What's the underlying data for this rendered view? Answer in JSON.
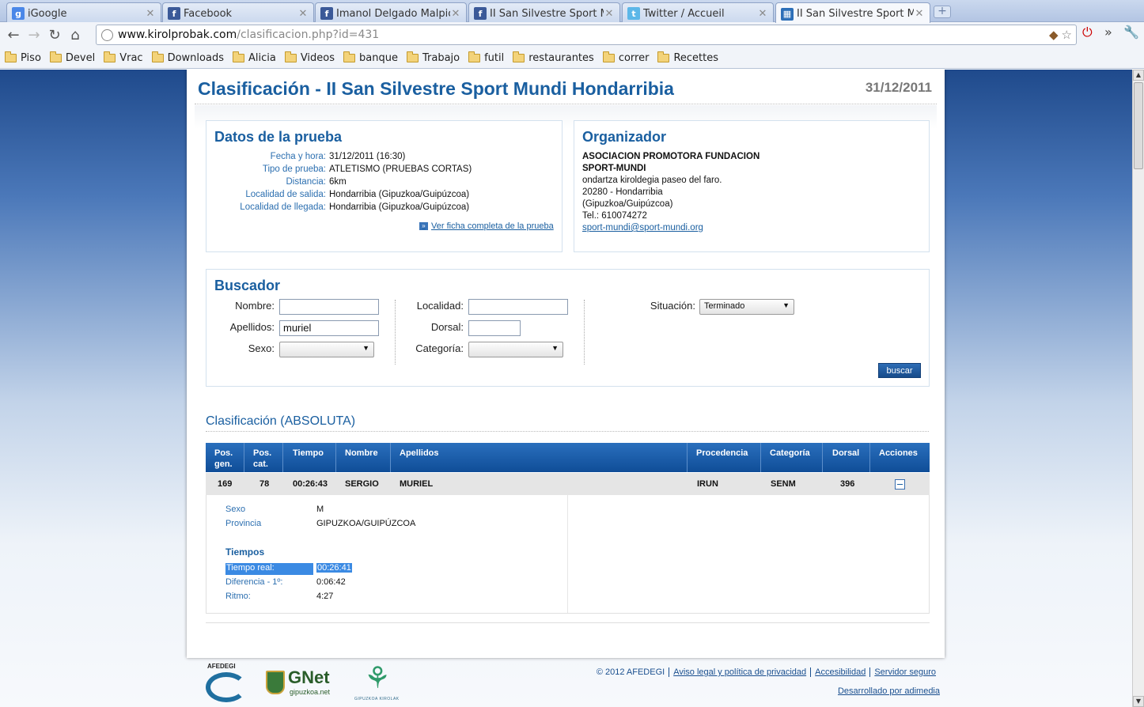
{
  "browser": {
    "tabs": [
      {
        "label": "iGoogle",
        "icon": "google-icon"
      },
      {
        "label": "Facebook",
        "icon": "facebook-icon"
      },
      {
        "label": "Imanol Delgado Malpica",
        "icon": "facebook-icon"
      },
      {
        "label": "II San Silvestre Sport M",
        "icon": "facebook-icon"
      },
      {
        "label": "Twitter / Accueil",
        "icon": "twitter-icon"
      },
      {
        "label": "II San Silvestre Sport M",
        "icon": "site-icon"
      }
    ],
    "url_host": "www.kirolprobak.com",
    "url_path": "/clasificacion.php?id=431",
    "bookmarks": [
      "Piso",
      "Devel",
      "Vrac",
      "Downloads",
      "Alicia",
      "Videos",
      "banque",
      "Trabajo",
      "futil",
      "restaurantes",
      "correr",
      "Recettes"
    ]
  },
  "page": {
    "title": "Clasificación - II San Silvestre Sport Mundi Hondarribia",
    "date": "31/12/2011"
  },
  "datos": {
    "title": "Datos de la prueba",
    "rows": [
      {
        "k": "Fecha y hora:",
        "v": "31/12/2011 (16:30)"
      },
      {
        "k": "Tipo de prueba:",
        "v": "ATLETISMO (PRUEBAS CORTAS)"
      },
      {
        "k": "Distancia:",
        "v": "6km"
      },
      {
        "k": "Localidad de salida:",
        "v": "Hondarribia (Gipuzkoa/Guipúzcoa)"
      },
      {
        "k": "Localidad de llegada:",
        "v": "Hondarribia (Gipuzkoa/Guipúzcoa)"
      }
    ],
    "link": "Ver ficha completa de la prueba"
  },
  "organizador": {
    "title": "Organizador",
    "name1": "ASOCIACION PROMOTORA FUNDACION",
    "name2": "SPORT-MUNDI",
    "addr1": "ondartza kiroldegia paseo del faro.",
    "addr2": "20280 - Hondarribia",
    "addr3": "(Gipuzkoa/Guipúzcoa)",
    "tel": "Tel.: 610074272",
    "email": "sport-mundi@sport-mundi.org"
  },
  "buscador": {
    "title": "Buscador",
    "nombre_label": "Nombre:",
    "nombre_value": "",
    "apellidos_label": "Apellidos:",
    "apellidos_value": "muriel",
    "sexo_label": "Sexo:",
    "sexo_value": "",
    "localidad_label": "Localidad:",
    "localidad_value": "",
    "dorsal_label": "Dorsal:",
    "dorsal_value": "",
    "categoria_label": "Categoría:",
    "categoria_value": "",
    "situacion_label": "Situación:",
    "situacion_value": "Terminado",
    "button": "buscar"
  },
  "clasificacion": {
    "title": "Clasificación (ABSOLUTA)",
    "headers": [
      "Pos. gen.",
      "Pos. cat.",
      "Tiempo",
      "Nombre",
      "Apellidos",
      "Procedencia",
      "Categoría",
      "Dorsal",
      "Acciones"
    ],
    "row": {
      "pos_gen": "169",
      "pos_cat": "78",
      "tiempo": "00:26:43",
      "nombre": "SERGIO",
      "apellidos": "MURIEL",
      "procedencia": "IRUN",
      "categoria": "SENM",
      "dorsal": "396"
    },
    "detail": {
      "sexo_k": "Sexo",
      "sexo_v": "M",
      "provincia_k": "Provincia",
      "provincia_v": "GIPUZKOA/GUIPÚZCOA",
      "tiempos_title": "Tiempos",
      "real_k": "Tiempo real:",
      "real_v": "00:26:41",
      "dif_k": "Diferencia - 1º:",
      "dif_v": "0:06:42",
      "ritmo_k": "Ritmo:",
      "ritmo_v": "4:27"
    }
  },
  "footer": {
    "copyright": "© 2012 AFEDEGI",
    "legal": "Aviso legal y política de privacidad",
    "accesibilidad": "Accesibilidad",
    "servidor": "Servidor seguro",
    "credit": "Desarrollado por adimedia",
    "logo_afedegi": "AFEDEGI",
    "logo_gnet": "GNet",
    "logo_gnet_sub": "gipuzkoa.net",
    "logo_kirolak": "GIPUZKOA KIROLAK"
  }
}
